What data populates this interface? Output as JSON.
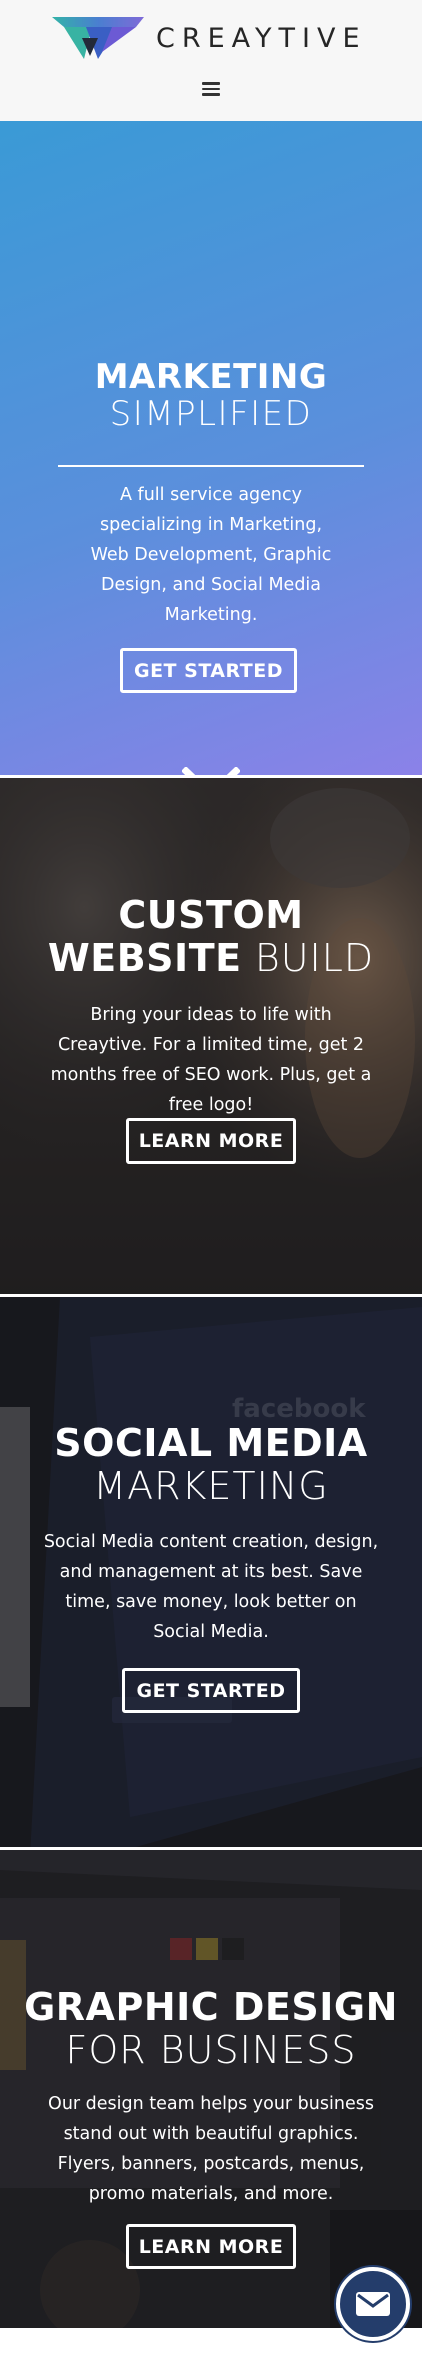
{
  "header": {
    "logo_text": "CREAYTIVE",
    "menu_icon": "hamburger-menu-icon"
  },
  "hero": {
    "title_bold": "MARKETING",
    "title_light": "SIMPLIFIED",
    "description": "A full service agency specializing in Marketing, Web Development, Graphic Design, and Social Media Marketing.",
    "button_label": "GET STARTED",
    "scroll_icon": "chevron-down-icon",
    "gradient": [
      "#3a9ad6",
      "#8b82e8"
    ]
  },
  "website_section": {
    "title_bold_line1": "CUSTOM",
    "title_bold_line2": "WEBSITE",
    "title_light": "BUILD",
    "description": "Bring your ideas to life with Creaytive. For a limited time, get 2 months free of SEO work. Plus, get a free logo!",
    "button_label": "LEARN MORE"
  },
  "social_section": {
    "title_bold": "SOCIAL MEDIA",
    "title_light": "MARKETING",
    "description": "Social Media content creation, design, and management at its best. Save time, save money, look better on Social Media.",
    "button_label": "GET STARTED"
  },
  "graphic_section": {
    "title_bold": "GRAPHIC DESIGN",
    "title_light": "FOR BUSINESS",
    "description": "Our design team helps your business stand out with beautiful graphics. Flyers, banners, postcards, menus, promo materials, and more.",
    "button_label": "LEARN MORE"
  },
  "contact_fab": {
    "icon": "envelope-icon",
    "color": "#243d6b"
  }
}
